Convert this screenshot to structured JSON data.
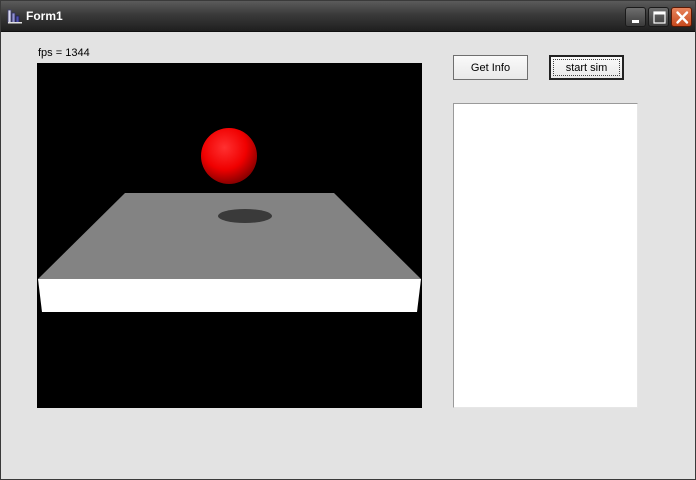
{
  "window": {
    "title": "Form1"
  },
  "fps_label": "fps = 1344",
  "buttons": {
    "get_info": "Get Info",
    "start_sim": "start sim"
  },
  "viewport": {
    "background_color": "#000000",
    "objects": [
      "red-sphere",
      "gray-platform",
      "platform-shadow"
    ]
  },
  "info_list": {
    "items": []
  }
}
